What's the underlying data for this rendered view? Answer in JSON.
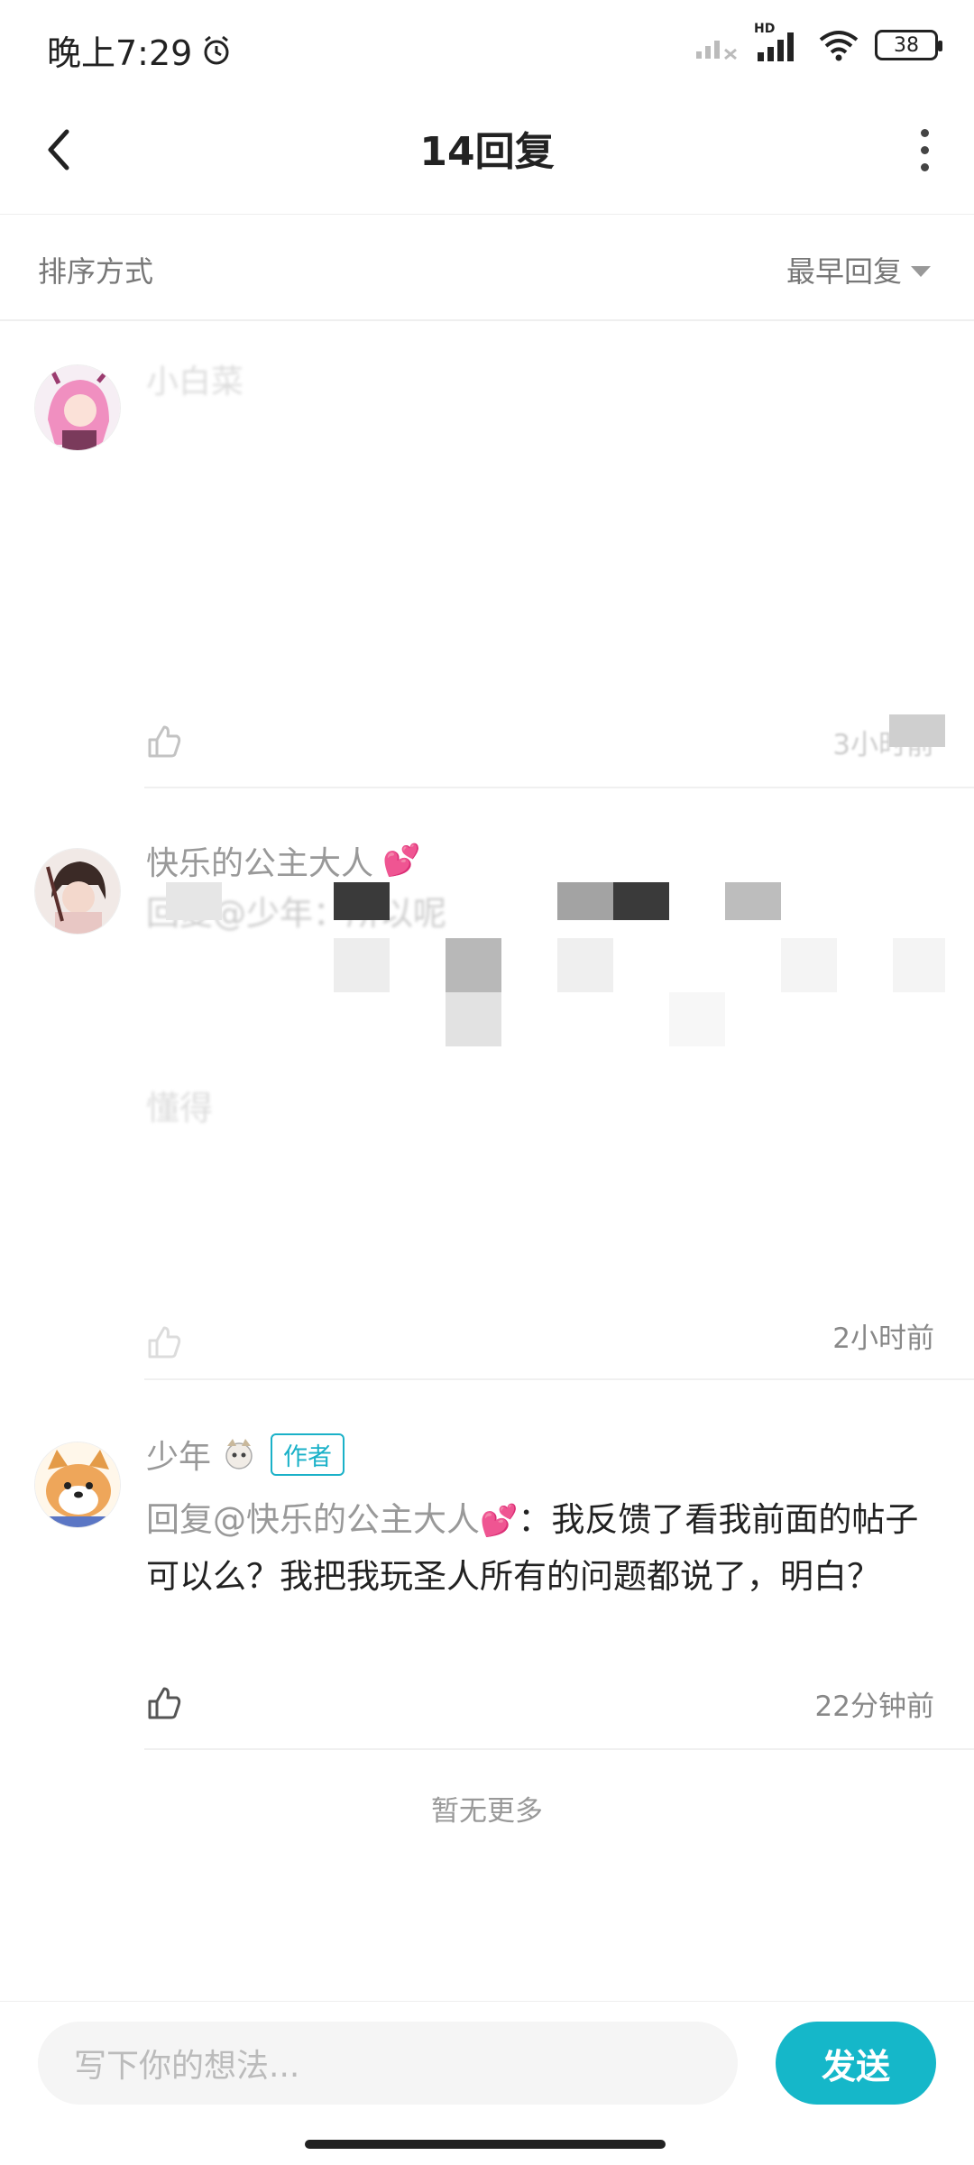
{
  "status_bar": {
    "time": "晚上7:29",
    "battery": "38",
    "hd_label": "HD"
  },
  "header": {
    "title": "14回复"
  },
  "sort": {
    "label": "排序方式",
    "value": "最早回复"
  },
  "replies": [
    {
      "name": "小白菜",
      "body_visible": "",
      "time": "3小时前"
    },
    {
      "name": "快乐的公主大人",
      "name_emoji": "💕",
      "body_partial": "回复@少年：所以呢",
      "body_partial2": "懂得",
      "time": "2小时前"
    },
    {
      "name": "少年",
      "tag": "作者",
      "mention": "回复@快乐的公主大人",
      "mention_emoji": "💕",
      "body": "：我反馈了看我前面的帖子可以么？我把我玩圣人所有的问题都说了，明白？",
      "time": "22分钟前"
    }
  ],
  "no_more": "暂无更多",
  "input": {
    "placeholder": "写下你的想法..."
  },
  "send_button": "发送",
  "colors": {
    "accent": "#15b7c9",
    "mention": "#999999",
    "heart": "#e64a8c"
  }
}
